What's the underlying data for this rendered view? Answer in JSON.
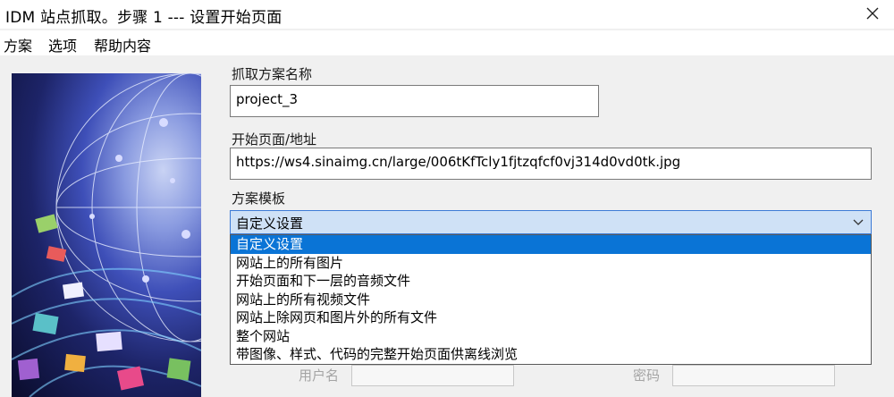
{
  "window": {
    "title": "IDM 站点抓取。步骤 1 --- 设置开始页面"
  },
  "menu": {
    "items": [
      "方案",
      "选项",
      "帮助内容"
    ]
  },
  "form": {
    "project_name_label": "抓取方案名称",
    "project_name_value": "project_3",
    "start_page_label": "开始页面/地址",
    "start_page_value": "https://ws4.sinaimg.cn/large/006tKfTcly1fjtzqfcf0vj314d0vd0tk.jpg",
    "template_label": "方案模板",
    "template_selected": "自定义设置",
    "template_options": [
      "自定义设置",
      "网站上的所有图片",
      "开始页面和下一层的音频文件",
      "网站上的所有视频文件",
      "网站上除网页和图片外的所有文件",
      "整个网站",
      "带图像、样式、代码的完整开始页面供离线浏览"
    ],
    "username_label": "用户名",
    "password_label": "密码"
  },
  "colors": {
    "combo_bg": "#cfe1f6",
    "combo_border": "#3d7bd6",
    "selected_option_bg": "#0a74d6"
  }
}
